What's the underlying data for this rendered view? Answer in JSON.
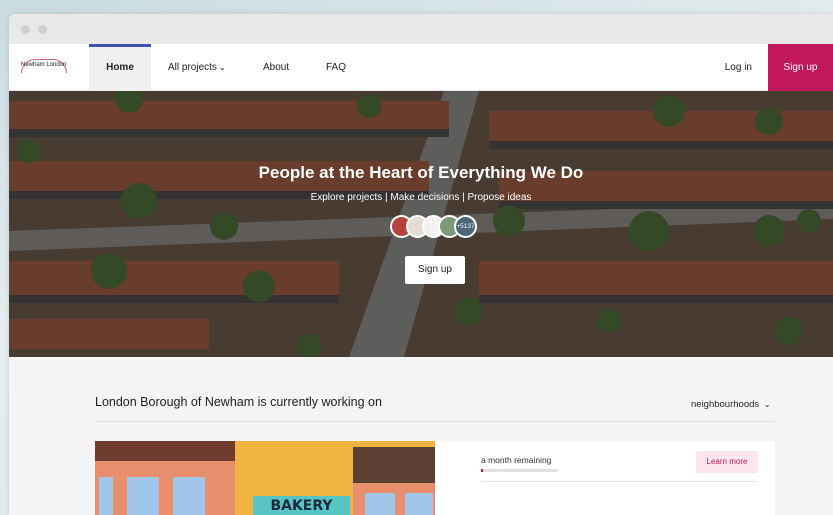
{
  "window": {
    "logo_text": "Newham London"
  },
  "nav": {
    "home": "Home",
    "all_projects": "All projects",
    "about": "About",
    "faq": "FAQ",
    "login": "Log in",
    "signup": "Sign up"
  },
  "hero": {
    "title": "People at the Heart of Everything We Do",
    "subtitle": "Explore projects | Make decisions | Propose ideas",
    "avatar_count": "+5137",
    "signup_button": "Sign up"
  },
  "section": {
    "title": "London Borough of Newham is currently working on",
    "filter": "neighbourhoods"
  },
  "card": {
    "image_sign": "BAKERY",
    "remaining": "a month remaining",
    "progress_fraction": 0.03,
    "learn_more": "Learn more"
  },
  "colors": {
    "brand": "#c2185b",
    "nav_active_border": "#3f51b5",
    "card_accent": "#59c4c4"
  }
}
